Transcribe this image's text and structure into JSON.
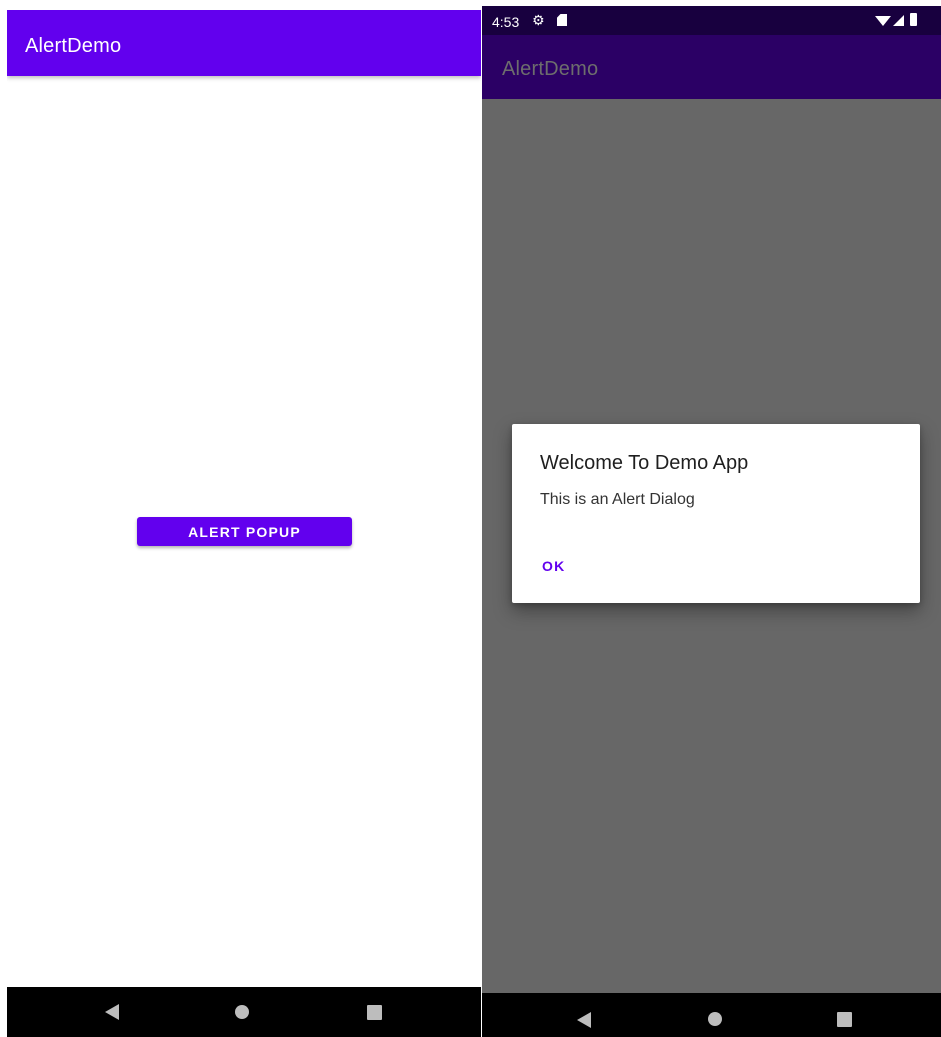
{
  "left_screen": {
    "app_title": "AlertDemo",
    "alert_button_label": "ALERT POPUP",
    "nav": {
      "back": "back-icon",
      "home": "home-icon",
      "recents": "recents-icon"
    }
  },
  "right_screen": {
    "status_bar": {
      "time": "4:53",
      "icons": [
        "settings-icon",
        "sd-card-icon",
        "wifi-icon",
        "signal-icon",
        "battery-icon"
      ]
    },
    "app_title": "AlertDemo",
    "dialog": {
      "title": "Welcome To Demo App",
      "message": "This is an Alert Dialog",
      "ok_label": "OK"
    },
    "nav": {
      "back": "back-icon",
      "home": "home-icon",
      "recents": "recents-icon"
    }
  },
  "colors": {
    "primary": "#6200ee",
    "dimmed_background": "#676767",
    "dimmed_status_bar": "#18003f",
    "dimmed_app_bar": "#2b0065"
  }
}
